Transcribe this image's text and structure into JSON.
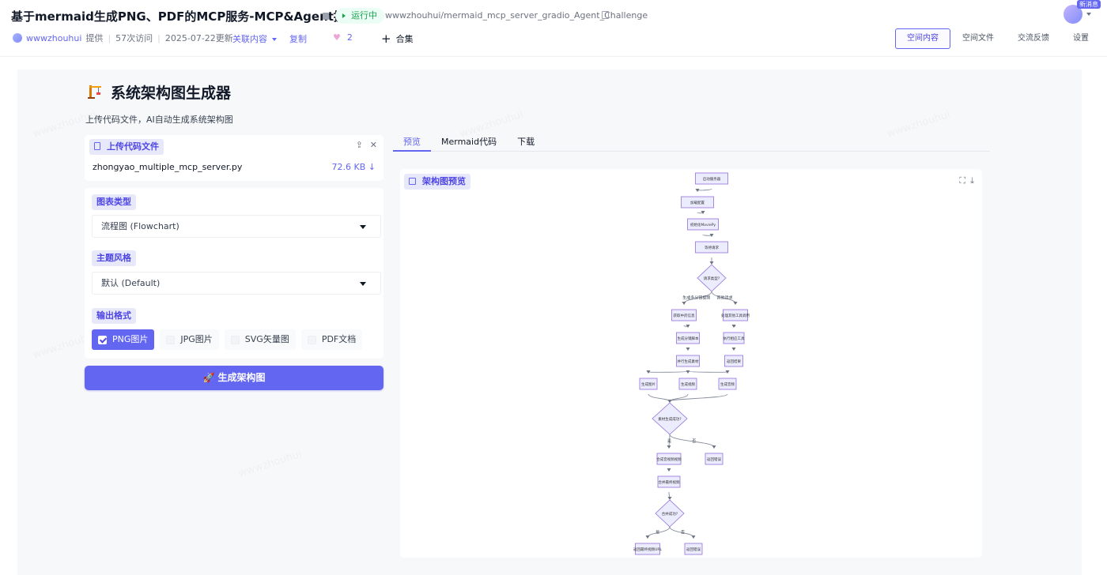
{
  "header": {
    "title": "基于mermaid生成PNG、PDF的MCP服务-MCP&Agent挑战赛",
    "status": "运行中",
    "repo": "wwwzhouhui/mermaid_mcp_server_gradio_Agent_Challenge",
    "author": "wwwzhouhui",
    "provided": "提供",
    "visits": "57次访问",
    "updated": "2025-07-22更新",
    "related": "关联内容",
    "copy": "复制",
    "likes": "2",
    "collection": "合集",
    "new_badge": "新消息",
    "tabs": [
      "空间内容",
      "空间文件",
      "交流反馈",
      "设置"
    ]
  },
  "app": {
    "title": "系统架构图生成器",
    "subtitle": "上传代码文件，AI自动生成系统架构图",
    "upload": {
      "label": "上传代码文件",
      "file_name": "zhongyao_multiple_mcp_server.py",
      "file_size": "72.6 KB ↓"
    },
    "chart_type": {
      "label": "图表类型",
      "value": "流程图 (Flowchart)"
    },
    "theme": {
      "label": "主题风格",
      "value": "默认 (Default)"
    },
    "output": {
      "label": "输出格式",
      "options": [
        {
          "label": "PNG图片",
          "checked": true
        },
        {
          "label": "JPG图片",
          "checked": false
        },
        {
          "label": "SVG矢量图",
          "checked": false
        },
        {
          "label": "PDF文档",
          "checked": false
        }
      ]
    },
    "generate_button": "🚀 生成架构图",
    "tabs": [
      "预览",
      "Mermaid代码",
      "下载"
    ],
    "preview_label": "架构图预览"
  },
  "diagram": {
    "nodes": [
      {
        "id": "n1",
        "text": "启动服务器",
        "shape": "rect"
      },
      {
        "id": "n2",
        "text": "加载配置",
        "shape": "rect"
      },
      {
        "id": "n3",
        "text": "初始化MoviePy",
        "shape": "rect"
      },
      {
        "id": "n4",
        "text": "等待请求",
        "shape": "rect"
      },
      {
        "id": "d1",
        "text": "请求类型?",
        "shape": "diamond"
      },
      {
        "id": "n5",
        "text": "获取中药信息",
        "shape": "rect"
      },
      {
        "id": "n6",
        "text": "处理其他工具调用",
        "shape": "rect"
      },
      {
        "id": "n7",
        "text": "生成分镜脚本",
        "shape": "rect"
      },
      {
        "id": "n8",
        "text": "执行相应工具",
        "shape": "rect"
      },
      {
        "id": "n9",
        "text": "并行生成素材",
        "shape": "rect"
      },
      {
        "id": "n10",
        "text": "返回结果",
        "shape": "rect"
      },
      {
        "id": "n11",
        "text": "生成图片",
        "shape": "rect"
      },
      {
        "id": "n12",
        "text": "生成视频",
        "shape": "rect"
      },
      {
        "id": "n13",
        "text": "生成音频",
        "shape": "rect"
      },
      {
        "id": "d2",
        "text": "素材生成成功?",
        "shape": "diamond"
      },
      {
        "id": "n14",
        "text": "合成音视频视频",
        "shape": "rect"
      },
      {
        "id": "n15",
        "text": "返回错误",
        "shape": "rect"
      },
      {
        "id": "n16",
        "text": "合并最终视频",
        "shape": "rect"
      },
      {
        "id": "d3",
        "text": "合并成功?",
        "shape": "diamond"
      },
      {
        "id": "n17",
        "text": "返回最终视频URL",
        "shape": "rect"
      },
      {
        "id": "n18",
        "text": "返回错误",
        "shape": "rect"
      }
    ],
    "edges": [
      {
        "from": "n1",
        "to": "n2",
        "label": ""
      },
      {
        "from": "n2",
        "to": "n3",
        "label": ""
      },
      {
        "from": "n3",
        "to": "n4",
        "label": ""
      },
      {
        "from": "n4",
        "to": "d1",
        "label": ""
      },
      {
        "from": "d1",
        "to": "n5",
        "label": "生成多分镜视频"
      },
      {
        "from": "d1",
        "to": "n6",
        "label": "其他请求"
      },
      {
        "from": "n5",
        "to": "n7",
        "label": ""
      },
      {
        "from": "n6",
        "to": "n8",
        "label": ""
      },
      {
        "from": "n7",
        "to": "n9",
        "label": ""
      },
      {
        "from": "n8",
        "to": "n10",
        "label": ""
      },
      {
        "from": "n9",
        "to": "n11",
        "label": ""
      },
      {
        "from": "n9",
        "to": "n12",
        "label": ""
      },
      {
        "from": "n9",
        "to": "n13",
        "label": ""
      },
      {
        "from": "n11",
        "to": "d2",
        "label": ""
      },
      {
        "from": "n12",
        "to": "d2",
        "label": ""
      },
      {
        "from": "n13",
        "to": "d2",
        "label": ""
      },
      {
        "from": "d2",
        "to": "n14",
        "label": "是"
      },
      {
        "from": "d2",
        "to": "n15",
        "label": "否"
      },
      {
        "from": "n14",
        "to": "n16",
        "label": ""
      },
      {
        "from": "n16",
        "to": "d3",
        "label": ""
      },
      {
        "from": "d3",
        "to": "n17",
        "label": "是"
      },
      {
        "from": "d3",
        "to": "n18",
        "label": "否"
      }
    ]
  }
}
